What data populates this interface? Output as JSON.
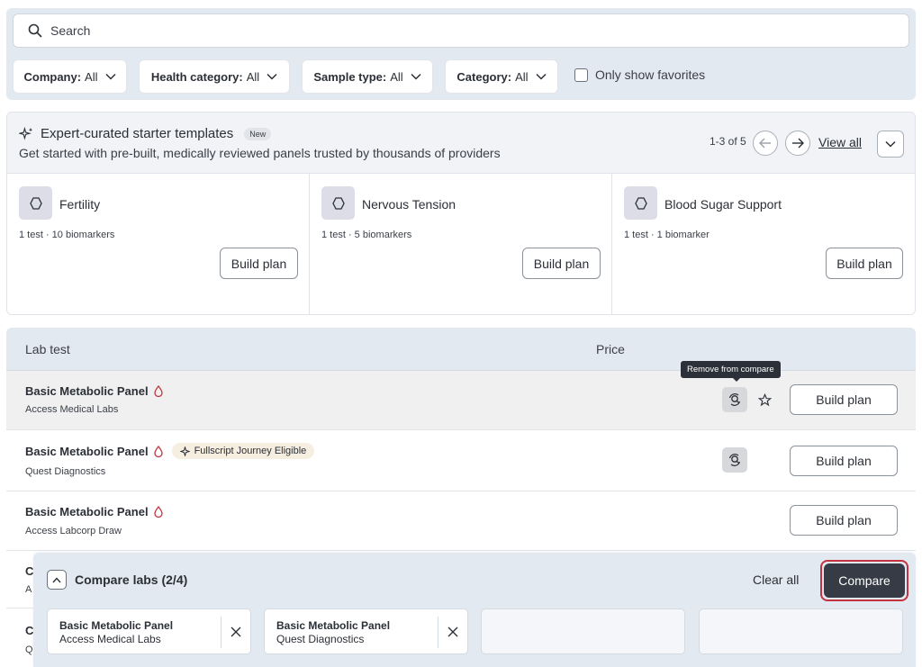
{
  "filters": {
    "search_placeholder": "Search",
    "company": {
      "label": "Company:",
      "value": "All"
    },
    "health_category": {
      "label": "Health category:",
      "value": "All"
    },
    "sample_type": {
      "label": "Sample type:",
      "value": "All"
    },
    "category": {
      "label": "Category:",
      "value": "All"
    },
    "favorites_label": "Only show favorites"
  },
  "templates": {
    "title": "Expert-curated starter templates",
    "badge": "New",
    "subtitle": "Get started with pre-built, medically reviewed panels trusted by thousands of providers",
    "pager": "1-3 of 5",
    "view_all": "View all",
    "cards": [
      {
        "name": "Fertility",
        "meta": "1 test · 10 biomarkers",
        "button": "Build plan"
      },
      {
        "name": "Nervous Tension",
        "meta": "1 test · 5 biomarkers",
        "button": "Build plan"
      },
      {
        "name": "Blood Sugar Support",
        "meta": "1 test · 1 biomarker",
        "button": "Build plan"
      }
    ]
  },
  "table": {
    "col_lab_test": "Lab test",
    "col_price": "Price",
    "tooltip": "Remove from compare",
    "rows": [
      {
        "title": "Basic Metabolic Panel",
        "lab": "Access Medical Labs",
        "button": "Build plan"
      },
      {
        "title": "Basic Metabolic Panel",
        "lab": "Quest Diagnostics",
        "pill": "Fullscript Journey Eligible",
        "button": "Build plan"
      },
      {
        "title": "Basic Metabolic Panel",
        "lab": "Access Labcorp Draw",
        "button": "Build plan"
      }
    ],
    "partial_rows": [
      {
        "title": "C",
        "lab": "A"
      },
      {
        "title": "C",
        "lab": "Q"
      }
    ]
  },
  "compare": {
    "title": "Compare labs (2/4)",
    "clear_all": "Clear all",
    "button": "Compare",
    "slots": [
      {
        "name": "Basic Metabolic Panel",
        "lab": "Access Medical Labs"
      },
      {
        "name": "Basic Metabolic Panel",
        "lab": "Quest Diagnostics"
      }
    ]
  },
  "colors": {
    "accent_dark": "#363b45",
    "highlight_ring": "#c2323f",
    "panel_bg": "#e3e9f1"
  }
}
